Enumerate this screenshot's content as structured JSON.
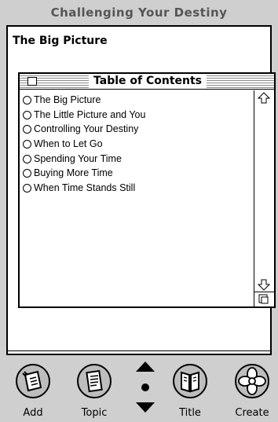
{
  "app": {
    "title": "Challenging Your Destiny"
  },
  "page": {
    "heading": "The Big Picture"
  },
  "toc": {
    "title": "Table of Contents",
    "items": [
      "The Big Picture",
      "The Little Picture and You",
      "Controlling Your Destiny",
      "When to Let Go",
      "Spending Your Time",
      "Buying More Time",
      "When Time Stands Still"
    ]
  },
  "nav": {
    "add": {
      "label": "Add",
      "icon": "add-page-icon"
    },
    "topic": {
      "label": "Topic",
      "icon": "topic-page-icon"
    },
    "arrows": {
      "up_icon": "arrow-up-icon",
      "dot_icon": "dot-icon",
      "down_icon": "arrow-down-icon"
    },
    "title": {
      "label": "Title",
      "icon": "title-book-icon"
    },
    "create": {
      "label": "Create",
      "icon": "create-flower-icon"
    }
  },
  "colors": {
    "background": "#cfcfcf",
    "panel": "#ffffff",
    "title_text": "#555555"
  }
}
